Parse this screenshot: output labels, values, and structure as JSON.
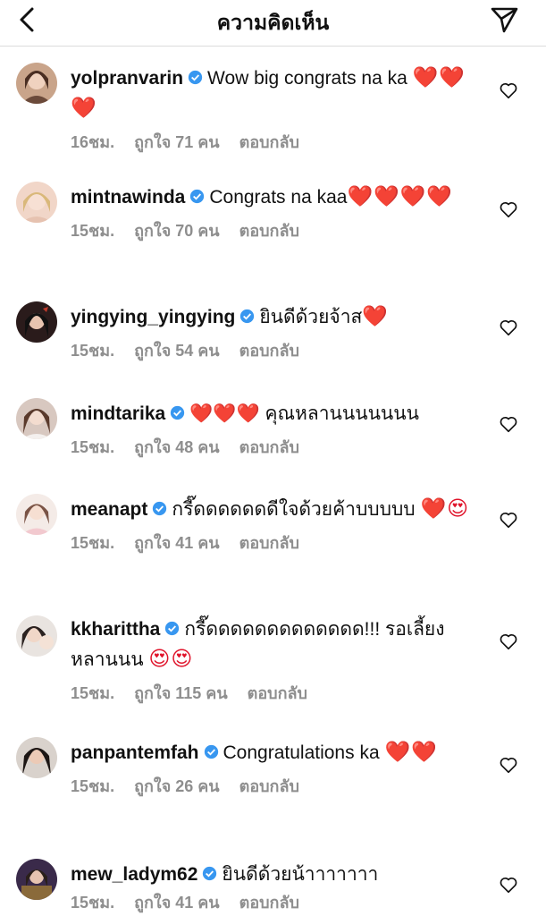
{
  "header": {
    "title": "ความคิดเห็น",
    "back_icon": "chevron-left-icon",
    "share_icon": "paper-plane-icon"
  },
  "colors": {
    "verified": "#3897f0",
    "heart": "#e0142b",
    "meta": "#8e8e8e"
  },
  "comments": [
    {
      "username": "yolpranvarin",
      "text": "Wow big congrats na ka",
      "emoji": "❤️❤️❤️",
      "time": "16ชม.",
      "likes": "ถูกใจ 71 คน",
      "reply": "ตอบกลับ"
    },
    {
      "username": "mintnawinda",
      "text": "Congrats na kaa",
      "emoji": "❤️❤️❤️❤️",
      "time": "15ชม.",
      "likes": "ถูกใจ 70 คน",
      "reply": "ตอบกลับ"
    },
    {
      "username": "yingying_yingying",
      "text": "ยินดีด้วยจ้าส",
      "emoji": "❤️",
      "time": "15ชม.",
      "likes": "ถูกใจ 54 คน",
      "reply": "ตอบกลับ"
    },
    {
      "username": "mindtarika",
      "text": "❤️❤️❤️ คุณหลานนนนนนน",
      "emoji": "",
      "time": "15ชม.",
      "likes": "ถูกใจ 48 คน",
      "reply": "ตอบกลับ"
    },
    {
      "username": "meanapt",
      "text": "กรี๊ดดดดดดดีใจด้วยค้าบบบบบ",
      "emoji": "❤️😍",
      "time": "15ชม.",
      "likes": "ถูกใจ 41 คน",
      "reply": "ตอบกลับ"
    },
    {
      "username": "kkharittha",
      "text": "กรี๊ดดดดดดดดดดดดด!!! รอเลี้ยงหลานนน",
      "emoji": "😍😍",
      "time": "15ชม.",
      "likes": "ถูกใจ 115 คน",
      "reply": "ตอบกลับ"
    },
    {
      "username": "panpantemfah",
      "text": "Congratulations ka",
      "emoji": "❤️❤️",
      "time": "15ชม.",
      "likes": "ถูกใจ 26 คน",
      "reply": "ตอบกลับ"
    },
    {
      "username": "mew_ladym62",
      "text": "ยินดีด้วยน้าาาาาาา",
      "emoji": "",
      "time": "15ชม.",
      "likes": "ถูกใจ 41 คน",
      "reply": "ตอบกลับ"
    }
  ]
}
